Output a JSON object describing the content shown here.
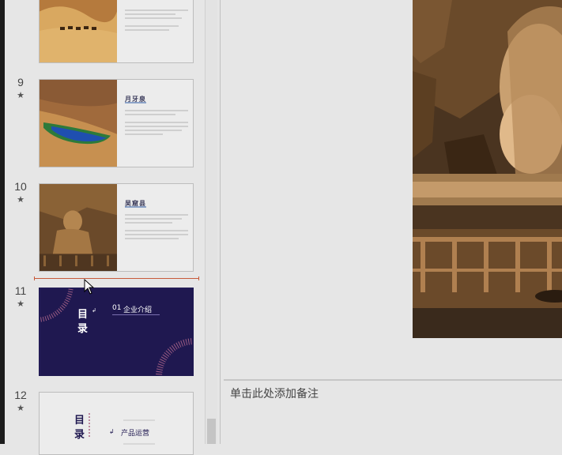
{
  "slides": [
    {
      "number": "9",
      "title": "月牙泉",
      "star": "★"
    },
    {
      "number": "10",
      "title": "吴窟县",
      "star": "★"
    },
    {
      "number": "11",
      "title": "企业介绍",
      "toc_char1": "目",
      "toc_char2": "录",
      "item_number": "01",
      "star": "★"
    },
    {
      "number": "12",
      "title": "产品运营",
      "toc_char1": "目",
      "toc_char2": "录",
      "star": "★"
    }
  ],
  "notes_placeholder": "单击此处添加备注",
  "colors": {
    "accent_line": "#c85a3a",
    "toc_bg": "#1f1850"
  },
  "icons": {
    "star": "star-icon",
    "cursor": "mouse-pointer-icon"
  }
}
